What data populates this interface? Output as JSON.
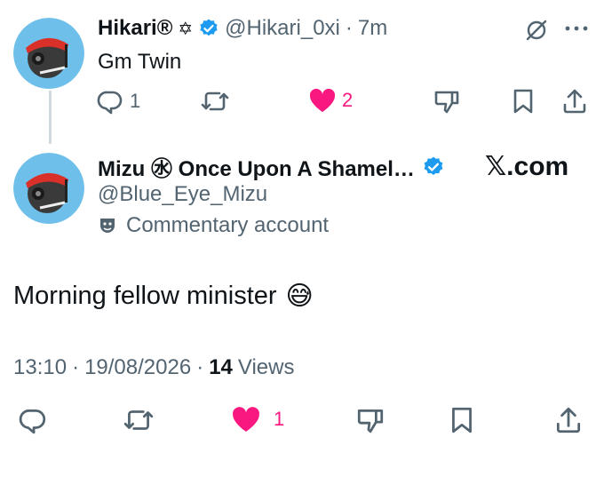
{
  "reply": {
    "name": "Hikari®",
    "name_symbol": "✡",
    "handle": "@Hikari_0xi",
    "separator": "·",
    "time": "7m",
    "text": "Gm Twin",
    "stats": {
      "replies": "1",
      "likes": "2"
    }
  },
  "main": {
    "name": "Mizu ㊌ Once Upon A Shamel…",
    "handle": "@Blue_Eye_Mizu",
    "badge_label": "Commentary account",
    "brand": "𝕏.com",
    "text": "Morning fellow minister",
    "emoji": "😅",
    "time": "13:10",
    "date": "19/08/2026",
    "separator": "·",
    "views_count": "14",
    "views_label": "Views",
    "stats": {
      "likes": "1"
    }
  },
  "colors": {
    "verified": "#1d9bf0",
    "like": "#f91880",
    "icon_gray": "#536471",
    "text": "#0f1419"
  },
  "icons": [
    "verified-badge-icon",
    "grok-icon",
    "more-icon",
    "reply-icon",
    "repost-icon",
    "like-icon",
    "dislike-icon",
    "bookmark-icon",
    "share-icon",
    "theater-mask-icon"
  ]
}
